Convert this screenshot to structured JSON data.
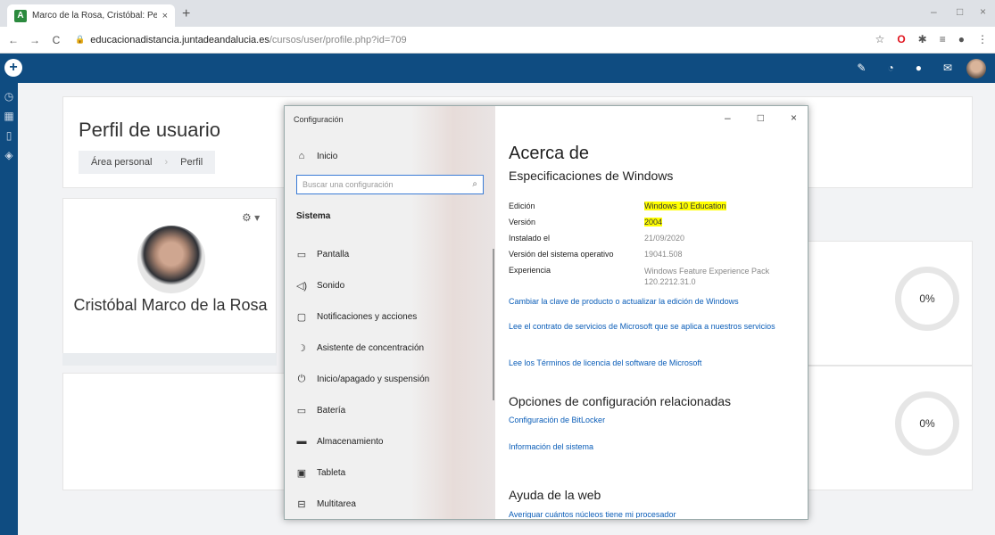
{
  "browser": {
    "tab_title": "Marco de la Rosa, Cristóbal: Perf",
    "tab_close": "×",
    "new_tab": "+",
    "favicon_letter": "A",
    "url_host": "educacionadistancia.juntadeandalucia.es",
    "url_path": "/cursos/user/profile.php?id=709",
    "window_controls": [
      "–",
      "□",
      "×"
    ]
  },
  "navbar": {
    "add": "+"
  },
  "page": {
    "title": "Perfil de usuario",
    "breadcrumb": [
      "Área personal",
      "Perfil"
    ],
    "user_name": "Cristóbal Marco de la Rosa",
    "progress": [
      "0%",
      "0%"
    ]
  },
  "settings": {
    "window_title": "Configuración",
    "home": "Inicio",
    "search_placeholder": "Buscar una configuración",
    "section": "Sistema",
    "items": [
      {
        "label": "Pantalla",
        "icon": "display-icon"
      },
      {
        "label": "Sonido",
        "icon": "sound-icon"
      },
      {
        "label": "Notificaciones y acciones",
        "icon": "notifications-icon"
      },
      {
        "label": "Asistente de concentración",
        "icon": "focus-assist-icon"
      },
      {
        "label": "Inicio/apagado y suspensión",
        "icon": "power-icon"
      },
      {
        "label": "Batería",
        "icon": "battery-icon"
      },
      {
        "label": "Almacenamiento",
        "icon": "storage-icon"
      },
      {
        "label": "Tableta",
        "icon": "tablet-icon"
      },
      {
        "label": "Multitarea",
        "icon": "multitask-icon"
      }
    ],
    "about_title": "Acerca de",
    "specs_title": "Especificaciones de Windows",
    "specs": [
      {
        "k": "Edición",
        "v": "Windows 10 Education",
        "highlight": true
      },
      {
        "k": "Versión",
        "v": "2004",
        "highlight": true
      },
      {
        "k": "Instalado el",
        "v": "21/09/2020",
        "highlight": false
      },
      {
        "k": "Versión del sistema operativo",
        "v": "19041.508",
        "highlight": false
      },
      {
        "k": "Experiencia",
        "v": "Windows Feature Experience Pack 120.2212.31.0",
        "highlight": false
      }
    ],
    "links": [
      "Cambiar la clave de producto o actualizar la edición de Windows",
      "Lee el contrato de servicios de Microsoft que se aplica a nuestros servicios",
      "Lee los Términos de licencia del software de Microsoft"
    ],
    "related_title": "Opciones de configuración relacionadas",
    "related_links": [
      "Configuración de BitLocker",
      "Información del sistema"
    ],
    "help_title": "Ayuda de la web",
    "help_link": "Averiguar cuántos núcleos tiene mi procesador",
    "highlight_color": "#ffff00"
  }
}
